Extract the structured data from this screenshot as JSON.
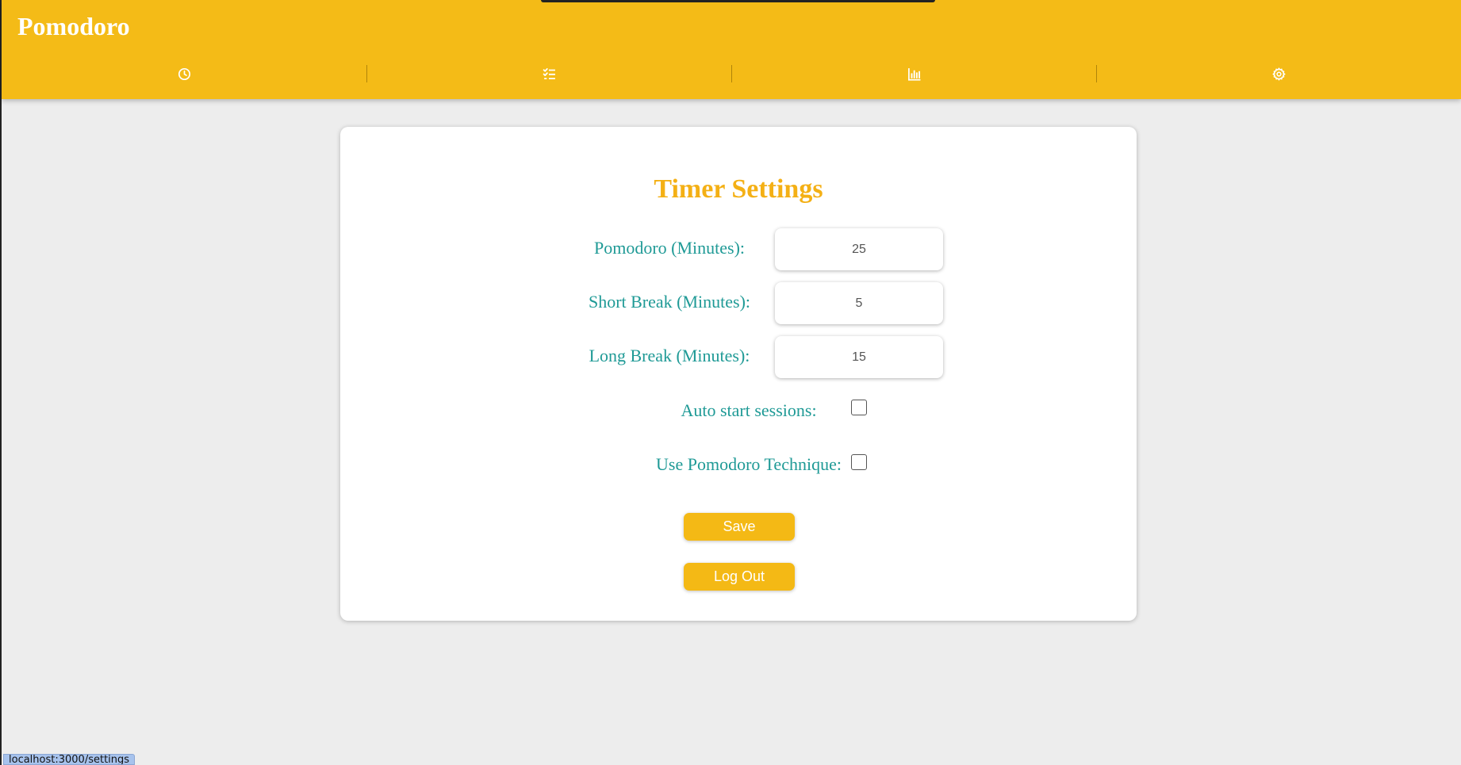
{
  "app": {
    "title": "Pomodoro",
    "accent_color": "#f4bb17",
    "label_color": "#1f9a96"
  },
  "nav": {
    "items": [
      {
        "icon": "clock-icon",
        "target": "timer"
      },
      {
        "icon": "checklist-icon",
        "target": "tasks"
      },
      {
        "icon": "bar-chart-icon",
        "target": "stats"
      },
      {
        "icon": "gear-icon",
        "target": "settings"
      }
    ]
  },
  "settings": {
    "title": "Timer Settings",
    "pomodoro": {
      "label": "Pomodoro (Minutes):",
      "value": "25"
    },
    "short_break": {
      "label": "Short Break (Minutes):",
      "value": "5"
    },
    "long_break": {
      "label": "Long Break (Minutes):",
      "value": "15"
    },
    "auto_start": {
      "label": "Auto start sessions:",
      "checked": false
    },
    "use_technique": {
      "label": "Use Pomodoro Technique:",
      "checked": false
    },
    "save_label": "Save",
    "logout_label": "Log Out"
  },
  "status_bar": {
    "url": "localhost:3000/settings"
  }
}
